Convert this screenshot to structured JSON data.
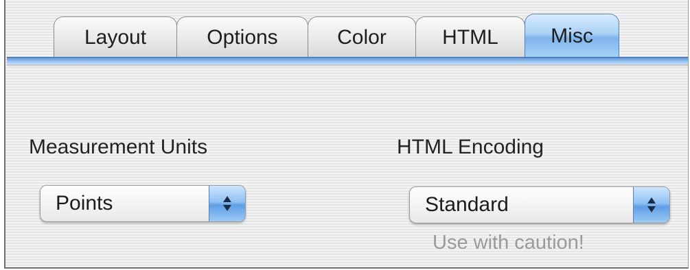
{
  "tabs": [
    {
      "label": "Layout",
      "active": false
    },
    {
      "label": "Options",
      "active": false
    },
    {
      "label": "Color",
      "active": false
    },
    {
      "label": "HTML",
      "active": false
    },
    {
      "label": "Misc",
      "active": true
    }
  ],
  "measurement_units": {
    "label": "Measurement Units",
    "selected": "Points"
  },
  "html_encoding": {
    "label": "HTML Encoding",
    "selected": "Standard",
    "note": "Use with caution!"
  },
  "colors": {
    "accent": "#7eb4ea",
    "caution_text": "#9a9a9a"
  },
  "icons": {
    "popup_arrows": "up-down-arrows-icon"
  }
}
